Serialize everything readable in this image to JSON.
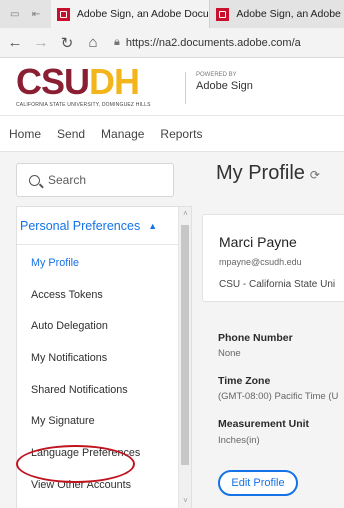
{
  "browser": {
    "tabs": [
      {
        "label": "Adobe Sign, an Adobe Docu"
      },
      {
        "label": "Adobe Sign, an Adobe"
      }
    ],
    "url": "https://na2.documents.adobe.com/a"
  },
  "header": {
    "logo_left": "CSU",
    "logo_right": "DH",
    "logo_subtitle": "CALIFORNIA STATE UNIVERSITY, DOMINGUEZ HILLS",
    "powered_by": "POWERED BY",
    "brand": "Adobe Sign"
  },
  "topnav": [
    "Home",
    "Send",
    "Manage",
    "Reports"
  ],
  "sidebar": {
    "search_placeholder": "Search",
    "section": "Personal Preferences",
    "items": [
      "My Profile",
      "Access Tokens",
      "Auto Delegation",
      "My Notifications",
      "Shared Notifications",
      "My Signature",
      "Language Preferences",
      "View Other Accounts"
    ],
    "active_index": 0
  },
  "profile": {
    "title": "My Profile",
    "name": "Marci Payne",
    "email": "mpayne@csudh.edu",
    "org": "CSU - California State Uni",
    "phone_label": "Phone Number",
    "phone_value": "None",
    "tz_label": "Time Zone",
    "tz_value": "(GMT-08:00) Pacific Time (U",
    "unit_label": "Measurement Unit",
    "unit_value": "Inches(in)",
    "edit_button": "Edit Profile"
  },
  "colors": {
    "accent": "#1473e6",
    "brand_maroon": "#8a1e32",
    "brand_gold": "#f2b51c",
    "highlight_red": "#c0141f"
  }
}
